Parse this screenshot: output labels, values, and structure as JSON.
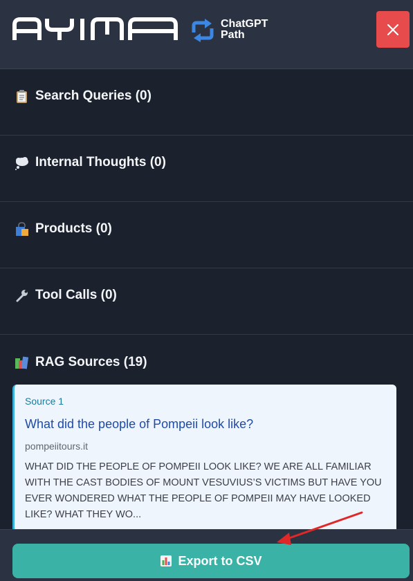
{
  "header": {
    "logo_text": "AYIMA",
    "brand_line1": "ChatGPT",
    "brand_line2": "Path",
    "close_icon": "close-icon",
    "close_color": "#e84b4b"
  },
  "sections": [
    {
      "label": "Search Queries (0)",
      "icon": "clipboard-icon"
    },
    {
      "label": "Internal Thoughts (0)",
      "icon": "thought-bubble-icon"
    },
    {
      "label": "Products (0)",
      "icon": "shopping-bag-icon"
    },
    {
      "label": "Tool Calls (0)",
      "icon": "wrench-icon"
    },
    {
      "label": "RAG Sources (19)",
      "icon": "books-icon"
    }
  ],
  "sources": [
    {
      "label": "Source 1",
      "title": "What did the people of Pompeii look like?",
      "domain": "pompeiitours.it",
      "snippet": "WHAT DID THE PEOPLE OF POMPEII LOOK LIKE? WE ARE ALL FAMILIAR WITH THE CAST BODIES OF MOUNT VESUVIUS’S VICTIMS BUT HAVE YOU EVER WONDERED WHAT THE PEOPLE OF POMPEII MAY HAVE LOOKED LIKE? WHAT THEY WO..."
    }
  ],
  "footer": {
    "export_label": "Export to CSV",
    "export_icon": "bar-chart-icon",
    "export_color": "#3ab3a6"
  },
  "colors": {
    "background": "#1b222e",
    "header": "#2b3343",
    "accent_arrow": "#e02828"
  }
}
